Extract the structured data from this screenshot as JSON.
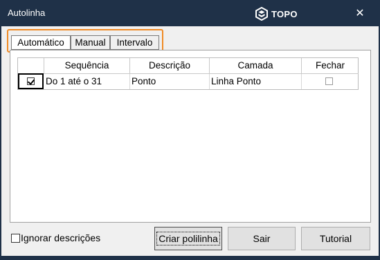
{
  "window": {
    "title": "Autolinha",
    "logo_text": "TOPO",
    "close_glyph": "✕"
  },
  "tabs": [
    {
      "label": "Automático",
      "active": true
    },
    {
      "label": "Manual",
      "active": false
    },
    {
      "label": "Intervalo",
      "active": false
    }
  ],
  "grid": {
    "columns": [
      "Sequência",
      "Descrição",
      "Camada",
      "Fechar"
    ],
    "rows": [
      {
        "selected": true,
        "sequencia": "Do 1 até o 31",
        "descricao": "Ponto",
        "camada": "Linha Ponto",
        "fechar": false
      }
    ]
  },
  "options": {
    "ignore_label": "Ignorar descrições",
    "ignore_checked": false
  },
  "buttons": {
    "criar": "Criar polilinha",
    "sair": "Sair",
    "tutorial": "Tutorial"
  },
  "colors": {
    "titlebar": "#1f3148",
    "tab_highlight": "#f08a24"
  }
}
